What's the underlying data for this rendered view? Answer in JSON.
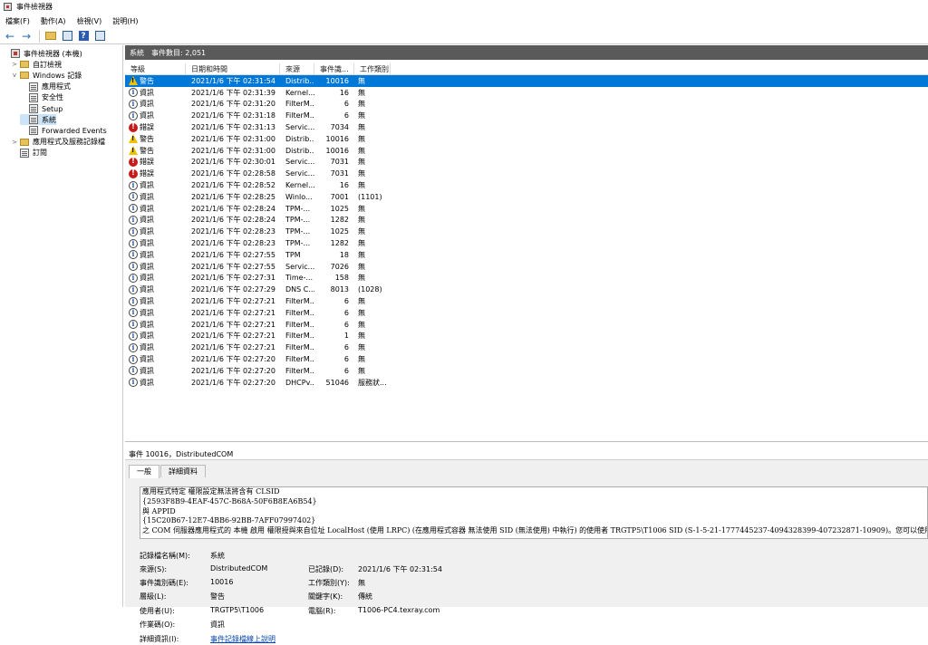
{
  "window": {
    "title": "事件檢視器"
  },
  "menu": [
    "檔案(F)",
    "動作(A)",
    "檢視(V)",
    "說明(H)"
  ],
  "toolbar_icons": [
    "back-arrow-icon",
    "forward-arrow-icon",
    "folder-up-icon",
    "console-tree-icon",
    "help-icon",
    "panel-icon"
  ],
  "tree": [
    {
      "label": "事件檢視器 (本機)",
      "icon": "event-viewer-icon",
      "expander": "",
      "indent": 0
    },
    {
      "label": "自訂檢視",
      "icon": "folder-icon",
      "expander": ">",
      "indent": 1
    },
    {
      "label": "Windows 記錄",
      "icon": "folder-icon",
      "expander": "v",
      "indent": 1
    },
    {
      "label": "應用程式",
      "icon": "log-icon",
      "expander": "",
      "indent": 2
    },
    {
      "label": "安全性",
      "icon": "log-icon",
      "expander": "",
      "indent": 2
    },
    {
      "label": "Setup",
      "icon": "log-icon",
      "expander": "",
      "indent": 2
    },
    {
      "label": "系統",
      "icon": "log-icon",
      "expander": "",
      "indent": 2,
      "selected": true
    },
    {
      "label": "Forwarded Events",
      "icon": "log-icon",
      "expander": "",
      "indent": 2
    },
    {
      "label": "應用程式及服務記錄檔",
      "icon": "folder-icon",
      "expander": ">",
      "indent": 1
    },
    {
      "label": "訂閱",
      "icon": "log-icon",
      "expander": "",
      "indent": 1
    }
  ],
  "header": {
    "name": "系統",
    "count": "事件數目: 2,051"
  },
  "columns": [
    "等級",
    "日期和時間",
    "來源",
    "事件識...",
    "工作類別"
  ],
  "rows": [
    {
      "level": "warn",
      "level_label": "警告",
      "time": "2021/1/6 下午 02:31:54",
      "source": "Distrib...",
      "id": "10016",
      "task": "無",
      "selected": true
    },
    {
      "level": "info",
      "level_label": "資訊",
      "time": "2021/1/6 下午 02:31:39",
      "source": "Kernel...",
      "id": "16",
      "task": "無"
    },
    {
      "level": "info",
      "level_label": "資訊",
      "time": "2021/1/6 下午 02:31:20",
      "source": "FilterM...",
      "id": "6",
      "task": "無"
    },
    {
      "level": "info",
      "level_label": "資訊",
      "time": "2021/1/6 下午 02:31:18",
      "source": "FilterM...",
      "id": "6",
      "task": "無"
    },
    {
      "level": "err",
      "level_label": "錯誤",
      "time": "2021/1/6 下午 02:31:13",
      "source": "Servic...",
      "id": "7034",
      "task": "無"
    },
    {
      "level": "warn",
      "level_label": "警告",
      "time": "2021/1/6 下午 02:31:00",
      "source": "Distrib...",
      "id": "10016",
      "task": "無"
    },
    {
      "level": "warn",
      "level_label": "警告",
      "time": "2021/1/6 下午 02:31:00",
      "source": "Distrib...",
      "id": "10016",
      "task": "無"
    },
    {
      "level": "err",
      "level_label": "錯誤",
      "time": "2021/1/6 下午 02:30:01",
      "source": "Servic...",
      "id": "7031",
      "task": "無"
    },
    {
      "level": "err",
      "level_label": "錯誤",
      "time": "2021/1/6 下午 02:28:58",
      "source": "Servic...",
      "id": "7031",
      "task": "無"
    },
    {
      "level": "info",
      "level_label": "資訊",
      "time": "2021/1/6 下午 02:28:52",
      "source": "Kernel...",
      "id": "16",
      "task": "無"
    },
    {
      "level": "info",
      "level_label": "資訊",
      "time": "2021/1/6 下午 02:28:25",
      "source": "Winlo...",
      "id": "7001",
      "task": "(1101)"
    },
    {
      "level": "info",
      "level_label": "資訊",
      "time": "2021/1/6 下午 02:28:24",
      "source": "TPM-...",
      "id": "1025",
      "task": "無"
    },
    {
      "level": "info",
      "level_label": "資訊",
      "time": "2021/1/6 下午 02:28:24",
      "source": "TPM-...",
      "id": "1282",
      "task": "無"
    },
    {
      "level": "info",
      "level_label": "資訊",
      "time": "2021/1/6 下午 02:28:23",
      "source": "TPM-...",
      "id": "1025",
      "task": "無"
    },
    {
      "level": "info",
      "level_label": "資訊",
      "time": "2021/1/6 下午 02:28:23",
      "source": "TPM-...",
      "id": "1282",
      "task": "無"
    },
    {
      "level": "info",
      "level_label": "資訊",
      "time": "2021/1/6 下午 02:27:55",
      "source": "TPM",
      "id": "18",
      "task": "無"
    },
    {
      "level": "info",
      "level_label": "資訊",
      "time": "2021/1/6 下午 02:27:55",
      "source": "Servic...",
      "id": "7026",
      "task": "無"
    },
    {
      "level": "info",
      "level_label": "資訊",
      "time": "2021/1/6 下午 02:27:31",
      "source": "Time-...",
      "id": "158",
      "task": "無"
    },
    {
      "level": "info",
      "level_label": "資訊",
      "time": "2021/1/6 下午 02:27:29",
      "source": "DNS C...",
      "id": "8013",
      "task": "(1028)"
    },
    {
      "level": "info",
      "level_label": "資訊",
      "time": "2021/1/6 下午 02:27:21",
      "source": "FilterM...",
      "id": "6",
      "task": "無"
    },
    {
      "level": "info",
      "level_label": "資訊",
      "time": "2021/1/6 下午 02:27:21",
      "source": "FilterM...",
      "id": "6",
      "task": "無"
    },
    {
      "level": "info",
      "level_label": "資訊",
      "time": "2021/1/6 下午 02:27:21",
      "source": "FilterM...",
      "id": "6",
      "task": "無"
    },
    {
      "level": "info",
      "level_label": "資訊",
      "time": "2021/1/6 下午 02:27:21",
      "source": "FilterM...",
      "id": "1",
      "task": "無"
    },
    {
      "level": "info",
      "level_label": "資訊",
      "time": "2021/1/6 下午 02:27:21",
      "source": "FilterM...",
      "id": "6",
      "task": "無"
    },
    {
      "level": "info",
      "level_label": "資訊",
      "time": "2021/1/6 下午 02:27:20",
      "source": "FilterM...",
      "id": "6",
      "task": "無"
    },
    {
      "level": "info",
      "level_label": "資訊",
      "time": "2021/1/6 下午 02:27:20",
      "source": "FilterM...",
      "id": "6",
      "task": "無"
    },
    {
      "level": "info",
      "level_label": "資訊",
      "time": "2021/1/6 下午 02:27:20",
      "source": "DHCPv...",
      "id": "51046",
      "task": "服務狀..."
    }
  ],
  "detail": {
    "title": "事件 10016，DistributedCOM",
    "tabs": [
      "一般",
      "詳細資料"
    ],
    "description": [
      "應用程式特定 權限設定無法將含有 CLSID",
      "{2593F8B9-4EAF-457C-B68A-50F6B8EA6B54}",
      "與 APPID",
      "{15C20B67-12E7-4BB6-92BB-7AFF07997402}",
      "之 COM 伺服器應用程式的 本機 啟用 權限授與來自位址 LocalHost (使用 LRPC) (在應用程式容器 無法使用 SID (無法使用) 中執行) 的使用者 TRGTP5\\T1006 SID (S-1-5-21-1777445237-4094328399-407232871-10909)。您可以使用元件服務系統管"
    ],
    "labels": {
      "log_name": "記錄檔名稱(M):",
      "source": "來源(S):",
      "logged": "已記錄(D):",
      "event_id": "事件識別碼(E):",
      "task": "工作類別(Y):",
      "level": "層級(L):",
      "keywords": "關鍵字(K):",
      "user": "使用者(U):",
      "computer": "電腦(R):",
      "opcode": "作業碼(O):",
      "more_info": "詳細資訊(I):"
    },
    "values": {
      "log_name": "系統",
      "source": "DistributedCOM",
      "logged": "2021/1/6 下午 02:31:54",
      "event_id": "10016",
      "task": "無",
      "level": "警告",
      "keywords": "傳統",
      "user": "TRGTP5\\T1006",
      "computer": "T1006-PC4.texray.com",
      "opcode": "資訊",
      "more_info": "事件記錄檔線上說明"
    }
  }
}
